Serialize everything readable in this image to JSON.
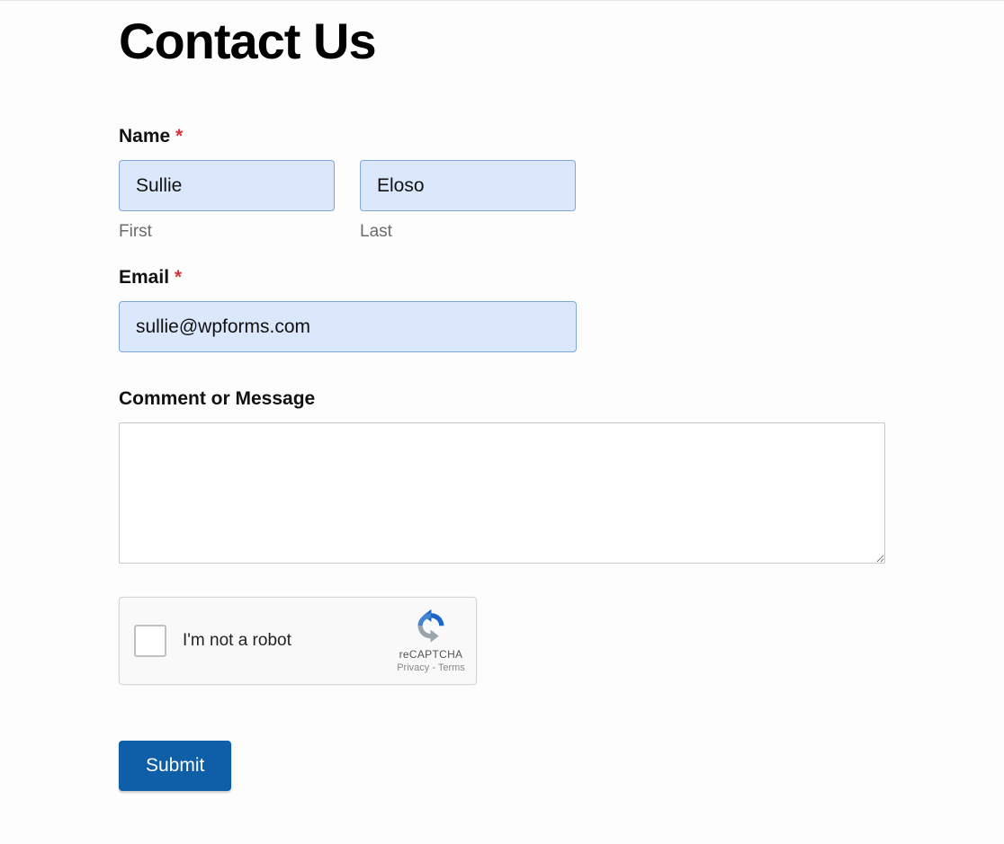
{
  "page": {
    "title": "Contact Us"
  },
  "fields": {
    "name": {
      "label": "Name",
      "required_mark": "*",
      "first": {
        "value": "Sullie",
        "sublabel": "First"
      },
      "last": {
        "value": "Eloso",
        "sublabel": "Last"
      }
    },
    "email": {
      "label": "Email",
      "required_mark": "*",
      "value": "sullie@wpforms.com"
    },
    "comment": {
      "label": "Comment or Message",
      "value": ""
    }
  },
  "recaptcha": {
    "label": "I'm not a robot",
    "brand": "reCAPTCHA",
    "privacy": "Privacy",
    "separator": " - ",
    "terms": "Terms"
  },
  "submit": {
    "label": "Submit"
  }
}
